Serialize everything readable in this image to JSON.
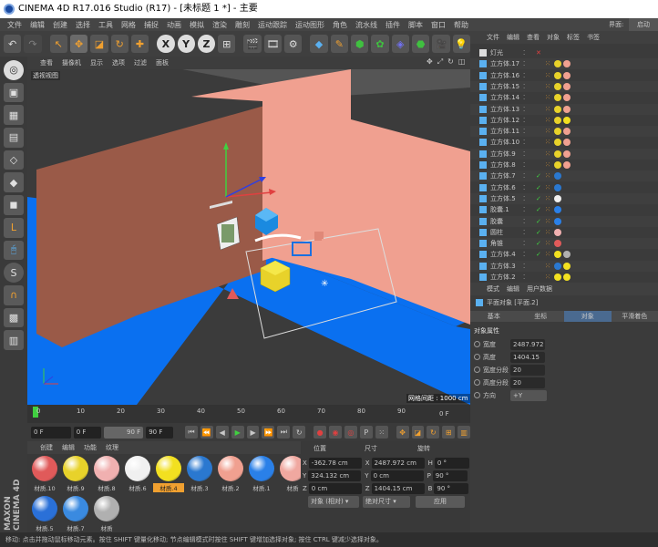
{
  "app": {
    "title": "CINEMA 4D R17.016 Studio (R17) - [未标题 1 *] - 主要",
    "layout_label": "界面:",
    "layout_value": "启动"
  },
  "menu": [
    "文件",
    "编辑",
    "创建",
    "选择",
    "工具",
    "网格",
    "捕捉",
    "动画",
    "模拟",
    "渲染",
    "雕刻",
    "运动跟踪",
    "运动图形",
    "角色",
    "流水线",
    "插件",
    "脚本",
    "窗口",
    "帮助"
  ],
  "viewport": {
    "menu": [
      "查看",
      "摄像机",
      "显示",
      "选项",
      "过滤",
      "面板"
    ],
    "label": "透视视图",
    "grid_spacing": "网格间距 : 1000 cm"
  },
  "timeline": {
    "ticks": [
      "0",
      "10",
      "20",
      "30",
      "40",
      "50",
      "60",
      "70",
      "80",
      "90"
    ],
    "end": "0 F"
  },
  "anim": {
    "current": "0 F",
    "start": "0 F",
    "end_a": "90 F",
    "end_b": "90 F"
  },
  "materials": {
    "menu": [
      "创建",
      "编辑",
      "功能",
      "纹理"
    ],
    "items": [
      {
        "label": "材质.10",
        "color": "#e05a5a"
      },
      {
        "label": "材质.9",
        "color": "#e8d22a"
      },
      {
        "label": "材质.8",
        "color": "#f0b0b0"
      },
      {
        "label": "材质.6",
        "color": "#f0f0f0"
      },
      {
        "label": "材质.4",
        "color": "#f2e020"
      },
      {
        "label": "材质.3",
        "color": "#2a78d0"
      },
      {
        "label": "材质.2",
        "color": "#f0a090"
      },
      {
        "label": "材质.1",
        "color": "#2a80e8"
      },
      {
        "label": "材质",
        "color": "#f0a8a0"
      },
      {
        "label": "材质.5",
        "color": "#2a70d8"
      },
      {
        "label": "材质.7",
        "color": "#3a8ae0"
      },
      {
        "label": "材质",
        "color": "#b0b0b0"
      }
    ],
    "selected_index": 4
  },
  "coords": {
    "headers": [
      "位置",
      "尺寸",
      "旋转"
    ],
    "rows": [
      {
        "a": "X",
        "pos": "-362.78 cm",
        "b": "X",
        "size": "2487.972 cm",
        "c": "H",
        "rot": "0 °"
      },
      {
        "a": "Y",
        "pos": "324.132 cm",
        "b": "Y",
        "size": "0 cm",
        "c": "P",
        "rot": "90 °"
      },
      {
        "a": "Z",
        "pos": "0 cm",
        "b": "Z",
        "size": "1404.15 cm",
        "c": "B",
        "rot": "90 °"
      }
    ],
    "mode": "对象 (相对)",
    "size_mode": "绝对尺寸",
    "apply": "应用"
  },
  "objects": {
    "menu": [
      "文件",
      "编辑",
      "查看",
      "对象",
      "标签",
      "书签"
    ],
    "rows": [
      {
        "name": "灯光",
        "tags": []
      },
      {
        "name": "立方体.17",
        "tags": [
          "#e8d22a",
          "#f0a090"
        ]
      },
      {
        "name": "立方体.16",
        "tags": [
          "#e8d22a",
          "#f0a090"
        ]
      },
      {
        "name": "立方体.15",
        "tags": [
          "#e8d22a",
          "#f0a090"
        ]
      },
      {
        "name": "立方体.14",
        "tags": [
          "#e8d22a",
          "#f0a090"
        ]
      },
      {
        "name": "立方体.13",
        "tags": [
          "#e8d22a",
          "#f0a090"
        ]
      },
      {
        "name": "立方体.12",
        "tags": [
          "#e8d22a",
          "#f2e020"
        ]
      },
      {
        "name": "立方体.11",
        "tags": [
          "#e8d22a",
          "#f0a090"
        ]
      },
      {
        "name": "立方体.10",
        "tags": [
          "#e8d22a",
          "#f0a090"
        ]
      },
      {
        "name": "立方体.9",
        "tags": [
          "#e8d22a",
          "#f0a090"
        ]
      },
      {
        "name": "立方体.8",
        "tags": [
          "#e8d22a",
          "#f0a090"
        ]
      },
      {
        "name": "立方体.7",
        "tags": [
          "#2a78d0"
        ]
      },
      {
        "name": "立方体.6",
        "tags": [
          "#2a78d0"
        ]
      },
      {
        "name": "立方体.5",
        "tags": [
          "#f0f0f0"
        ]
      },
      {
        "name": "胶囊.1",
        "tags": [
          "#2a80e8"
        ]
      },
      {
        "name": "胶囊",
        "tags": [
          "#2a80e8"
        ]
      },
      {
        "name": "圆柱",
        "tags": [
          "#f0b0b0"
        ]
      },
      {
        "name": "角锥",
        "tags": [
          "#e05a5a"
        ]
      },
      {
        "name": "立方体.4",
        "tags": [
          "#f2e020",
          "#b0b0b0"
        ]
      },
      {
        "name": "立方体.3",
        "tags": [
          "#2a78d0",
          "#f2e020"
        ]
      },
      {
        "name": "立方体.2",
        "tags": [
          "#f2e020",
          "#f2e020"
        ]
      }
    ]
  },
  "attributes": {
    "menu": [
      "模式",
      "编辑",
      "用户数据"
    ],
    "object_label": "平面对象 [平面.2]",
    "tabs": [
      "基本",
      "坐标",
      "对象",
      "平滑着色"
    ],
    "active_tab": 2,
    "section": "对象属性",
    "fields": [
      {
        "label": "宽度",
        "value": "2487.972"
      },
      {
        "label": "高度",
        "value": "1404.15 c"
      },
      {
        "label": "宽度分段",
        "value": "20"
      },
      {
        "label": "高度分段",
        "value": "20"
      },
      {
        "label": "方向",
        "value": "+Y"
      }
    ]
  },
  "status": "移动: 点击并拖动鼠标移动元素。按住 SHIFT 键量化移动; 节点编辑模式时按住 SHIFT 键增加选择对象; 按住 CTRL 键减少选择对象。",
  "colors": {
    "floor": "#0a70f0",
    "wall_pink": "#f0a090",
    "wall_brown": "#9a5a48",
    "accent": "#f0a030"
  }
}
